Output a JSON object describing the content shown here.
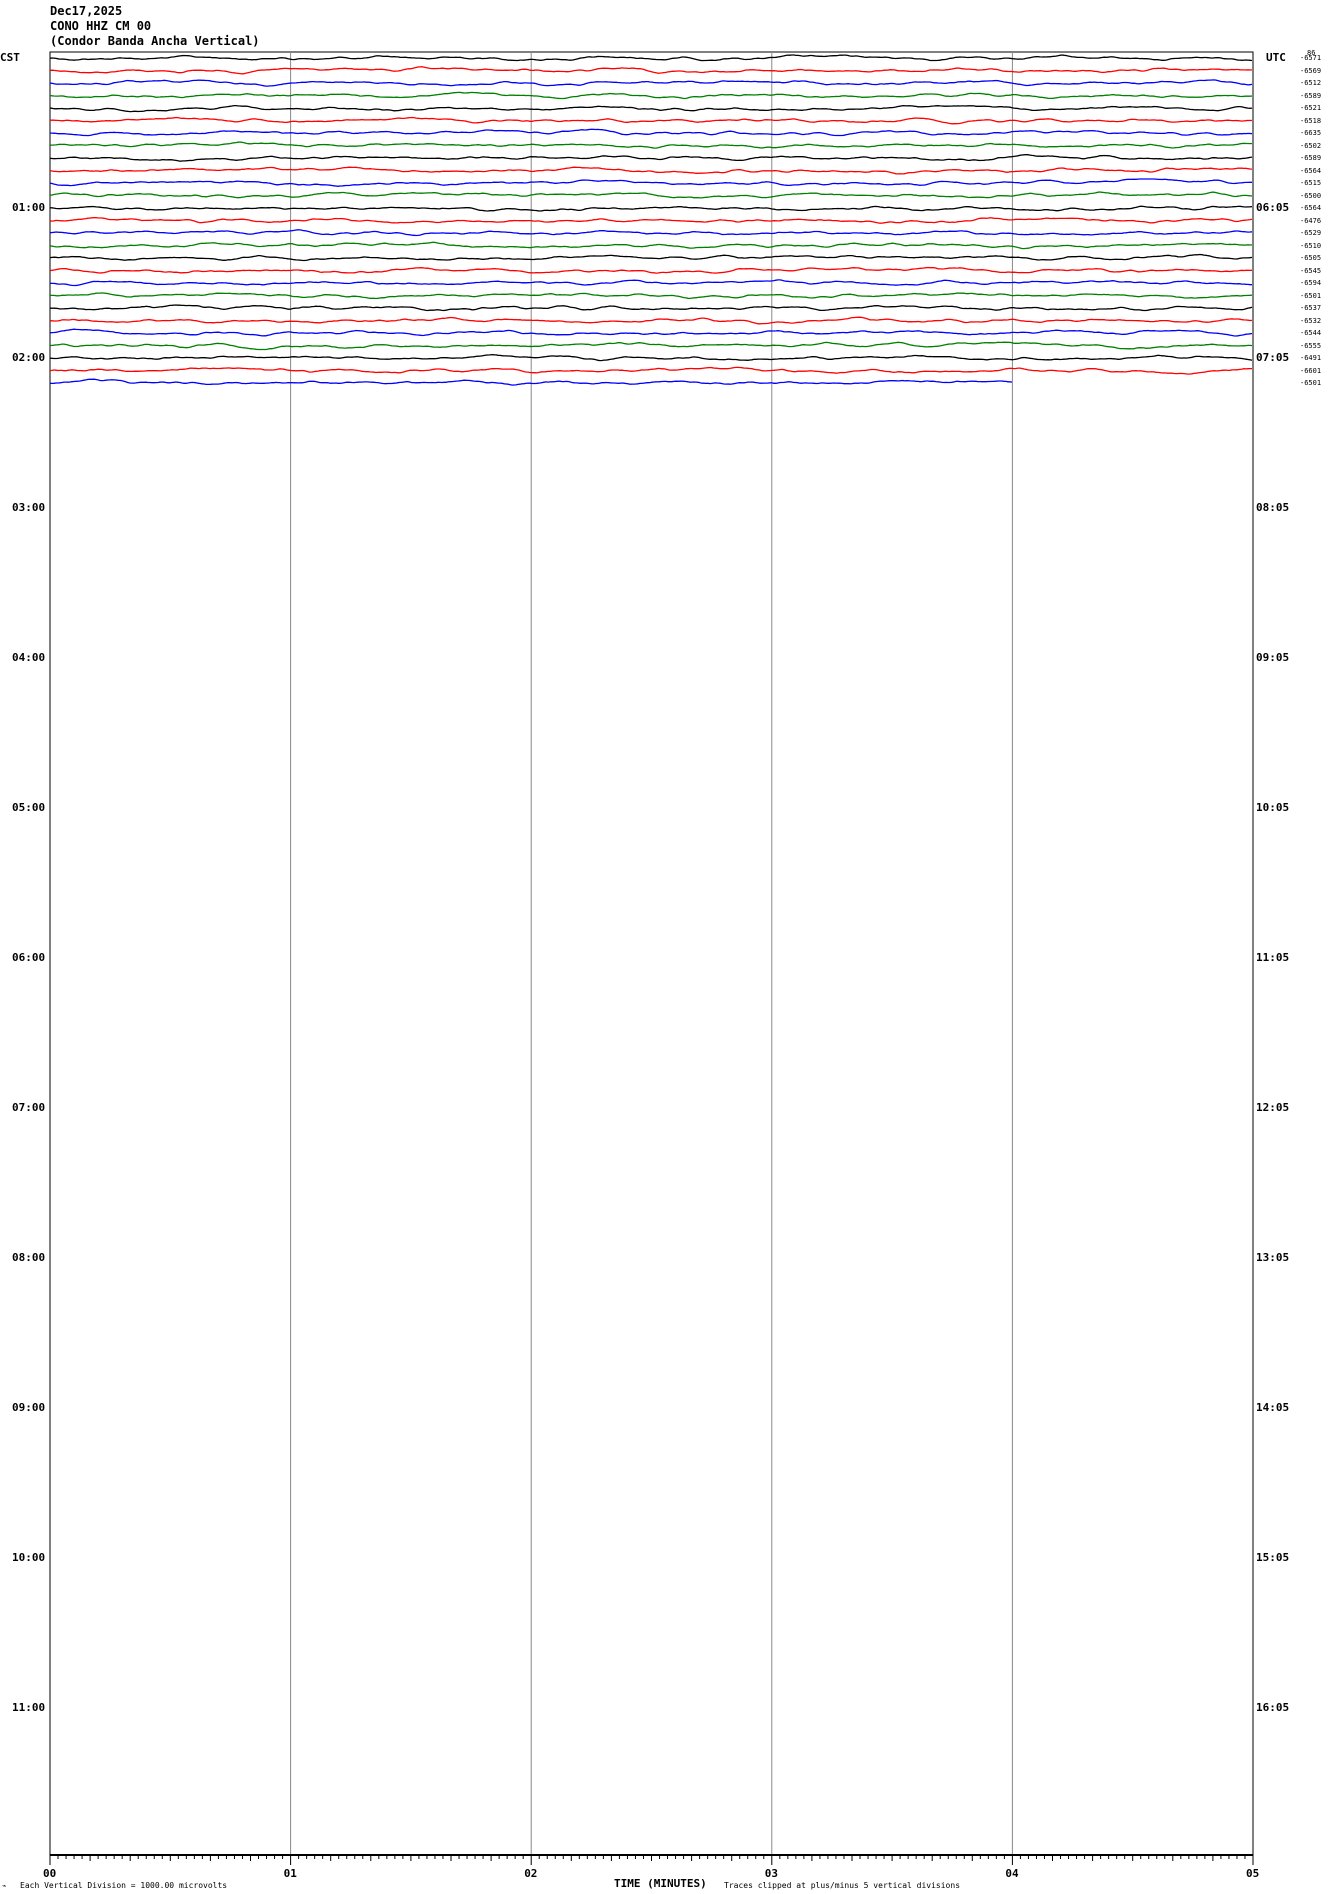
{
  "header": {
    "date": "Dec17,2025",
    "station": "CONO HHZ CM 00",
    "name": "(Condor Banda Ancha Vertical)"
  },
  "left_tz": "CST",
  "right_tz": "UTC",
  "top_right_mark": "86",
  "footer": {
    "scale_text": "Each Vertical Division = 1000.00 microvolts",
    "xlabel": "TIME (MINUTES)",
    "clip_text": "Traces clipped at plus/minus 5 vertical divisions"
  },
  "chart_data": {
    "type": "line",
    "title": "CONO HHZ CM 00 helicorder",
    "xlabel": "TIME (MINUTES)",
    "xlim": [
      0,
      5
    ],
    "x_ticks": [
      "00",
      "01",
      "02",
      "03",
      "04",
      "05"
    ],
    "left_hour_labels": [
      "CST",
      "01:00",
      "02:00",
      "03:00",
      "04:00",
      "05:00",
      "06:00",
      "07:00",
      "08:00",
      "09:00",
      "10:00",
      "11:00"
    ],
    "right_hour_labels": [
      "",
      "06:05",
      "07:05",
      "08:05",
      "09:05",
      "10:05",
      "11:05",
      "12:05",
      "13:05",
      "14:05",
      "15:05",
      "16:05"
    ],
    "rows_per_hour": 12,
    "trace_colors": [
      "#000000",
      "#ff0000",
      "#0000ff",
      "#008000"
    ],
    "trace_offsets": [
      "-6571",
      "-6569",
      "-6512",
      "-6589",
      "-6521",
      "-6518",
      "-6635",
      "-6502",
      "-6589",
      "-6564",
      "-6515",
      "-6500",
      "-6564",
      "-6476",
      "-6529",
      "-6510",
      "-6505",
      "-6545",
      "-6594",
      "-6501",
      "-6537",
      "-6532",
      "-6544",
      "-6555",
      "-6491",
      "-6601",
      "-6501"
    ],
    "last_trace_end_minute": 4
  }
}
